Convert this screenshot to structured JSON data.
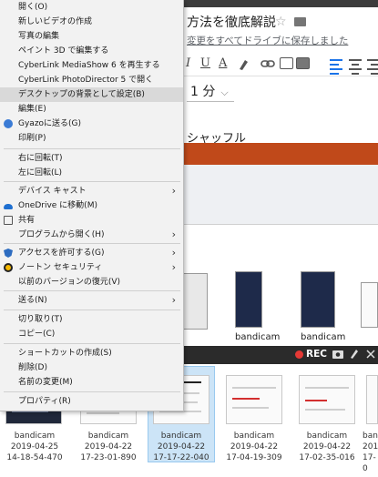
{
  "document": {
    "title": "方法を徹底解説",
    "star_glyph": "☆",
    "saved_status": "変更をすべてドライブに保存しました",
    "toolbar": {
      "italic": "I",
      "underline": "U",
      "color": "A"
    },
    "time_select": "1 分",
    "time_chevron": "⌵",
    "heading": "シャッフル"
  },
  "recorder": {
    "rec_label": "REC"
  },
  "explorer": {
    "thumb_labels": [
      {
        "name": "bandicam",
        "date": "2019-04-25",
        "time": "14-18-54-470"
      },
      {
        "name": "bandicam",
        "date": "2019-04-22",
        "time": "17-23-01-890"
      },
      {
        "name": "bandicam",
        "date": "2019-04-22",
        "time": "17-17-22-040"
      },
      {
        "name": "bandicam",
        "date": "2019-04-22",
        "time": "17-04-19-309"
      },
      {
        "name": "bandicam",
        "date": "2019-04-22",
        "time": "17-02-35-016"
      },
      {
        "name": "ban",
        "date": "2019",
        "time": "17-0"
      }
    ],
    "mid_labels": [
      "bandicam",
      "bandicam"
    ]
  },
  "context_menu": {
    "items": [
      {
        "label": "開く(O)"
      },
      {
        "label": "新しいビデオの作成"
      },
      {
        "label": "写真の編集"
      },
      {
        "label": "ペイント 3D で編集する"
      },
      {
        "label": "CyberLink MediaShow 6 を再生する"
      },
      {
        "label": "CyberLink PhotoDirector 5 で開く"
      },
      {
        "label": "デスクトップの背景として設定(B)",
        "highlighted": true
      },
      {
        "label": "編集(E)"
      },
      {
        "label": "Gyazoに送る(G)",
        "icon": "gyazo-icon"
      },
      {
        "label": "印刷(P)"
      },
      {
        "label": "右に回転(T)"
      },
      {
        "label": "左に回転(L)"
      },
      {
        "label": "デバイス キャスト",
        "submenu": true
      },
      {
        "label": "OneDrive に移動(M)",
        "icon": "onedrive-icon"
      },
      {
        "label": "共有",
        "icon": "share-icon"
      },
      {
        "label": "プログラムから開く(H)",
        "submenu": true
      },
      {
        "label": "アクセスを許可する(G)",
        "icon": "shield-icon",
        "submenu": true
      },
      {
        "label": "ノートン セキュリティ",
        "icon": "norton-icon",
        "submenu": true
      },
      {
        "label": "以前のバージョンの復元(V)"
      },
      {
        "label": "送る(N)",
        "submenu": true
      },
      {
        "label": "切り取り(T)"
      },
      {
        "label": "コピー(C)"
      },
      {
        "label": "ショートカットの作成(S)"
      },
      {
        "label": "削除(D)"
      },
      {
        "label": "名前の変更(M)"
      },
      {
        "label": "プロパティ(R)"
      }
    ],
    "submenu_arrow": "›"
  }
}
